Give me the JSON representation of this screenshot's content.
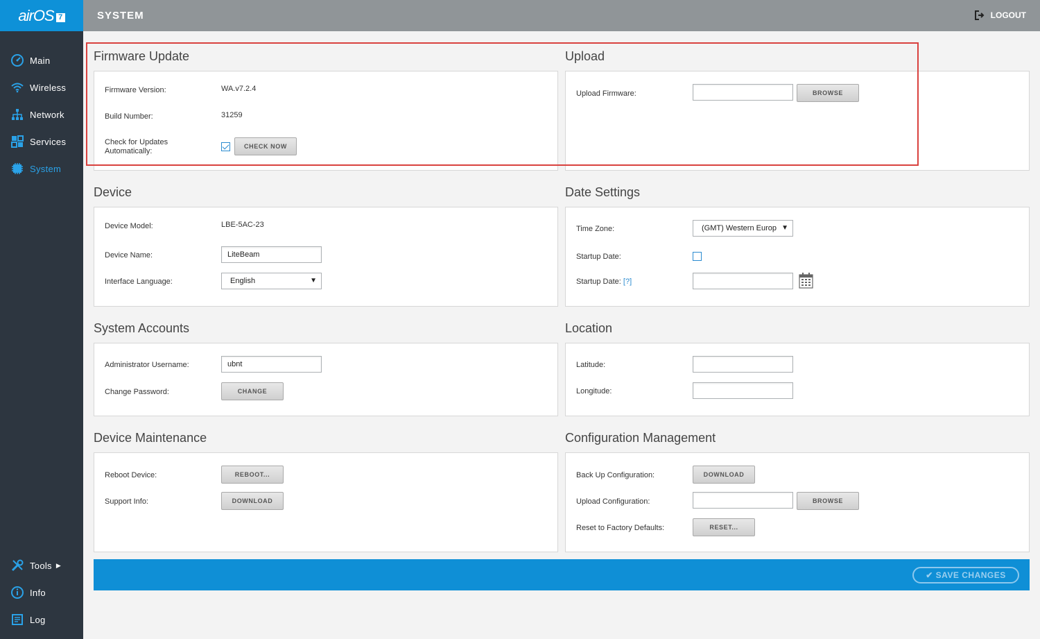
{
  "app": {
    "logo_text": "airOS",
    "logo_version": "7",
    "page_title": "SYSTEM",
    "logout_label": "LOGOUT"
  },
  "sidebar": {
    "items": [
      {
        "label": "Main",
        "icon": "gauge-icon"
      },
      {
        "label": "Wireless",
        "icon": "wifi-icon"
      },
      {
        "label": "Network",
        "icon": "network-icon"
      },
      {
        "label": "Services",
        "icon": "services-icon"
      },
      {
        "label": "System",
        "icon": "system-icon",
        "active": true
      }
    ],
    "bottom_items": [
      {
        "label": "Tools",
        "icon": "tools-icon"
      },
      {
        "label": "Info",
        "icon": "info-icon"
      },
      {
        "label": "Log",
        "icon": "log-icon"
      }
    ]
  },
  "firmware": {
    "title": "Firmware Update",
    "version_label": "Firmware Version:",
    "version_value": "WA.v7.2.4",
    "build_label": "Build Number:",
    "build_value": "31259",
    "check_label_line1": "Check for Updates",
    "check_label_line2": "Automatically:",
    "check_checked": true,
    "check_now_label": "CHECK NOW"
  },
  "upload": {
    "title": "Upload",
    "firmware_label": "Upload Firmware:",
    "firmware_value": "",
    "browse_label": "BROWSE"
  },
  "device": {
    "title": "Device",
    "model_label": "Device Model:",
    "model_value": "LBE-5AC-23",
    "name_label": "Device Name:",
    "name_value": "LiteBeam",
    "language_label": "Interface Language:",
    "language_value": "English"
  },
  "date_settings": {
    "title": "Date Settings",
    "timezone_label": "Time Zone:",
    "timezone_value": "(GMT) Western Europ",
    "startup_date_label": "Startup Date:",
    "startup_date_checked": false,
    "startup_date2_label": "Startup Date:",
    "help_text": "[?]",
    "startup_date_value": ""
  },
  "accounts": {
    "title": "System Accounts",
    "admin_label": "Administrator Username:",
    "admin_value": "ubnt",
    "password_label": "Change Password:",
    "change_label": "CHANGE"
  },
  "location": {
    "title": "Location",
    "latitude_label": "Latitude:",
    "latitude_value": "",
    "longitude_label": "Longitude:",
    "longitude_value": ""
  },
  "maintenance": {
    "title": "Device Maintenance",
    "reboot_label": "Reboot Device:",
    "reboot_button": "REBOOT...",
    "support_label": "Support Info:",
    "download_button": "DOWNLOAD"
  },
  "config": {
    "title": "Configuration Management",
    "backup_label": "Back Up Configuration:",
    "download_button": "DOWNLOAD",
    "upload_label": "Upload Configuration:",
    "upload_value": "",
    "browse_button": "BROWSE",
    "reset_label": "Reset to Factory Defaults:",
    "reset_button": "RESET..."
  },
  "footer": {
    "save_label": "SAVE CHANGES"
  },
  "colors": {
    "accent": "#0f8fd6",
    "sidebar_bg": "#2d3640",
    "header_bg": "#909598",
    "active_nav": "#2aa2e8",
    "highlight": "#d9413e"
  }
}
